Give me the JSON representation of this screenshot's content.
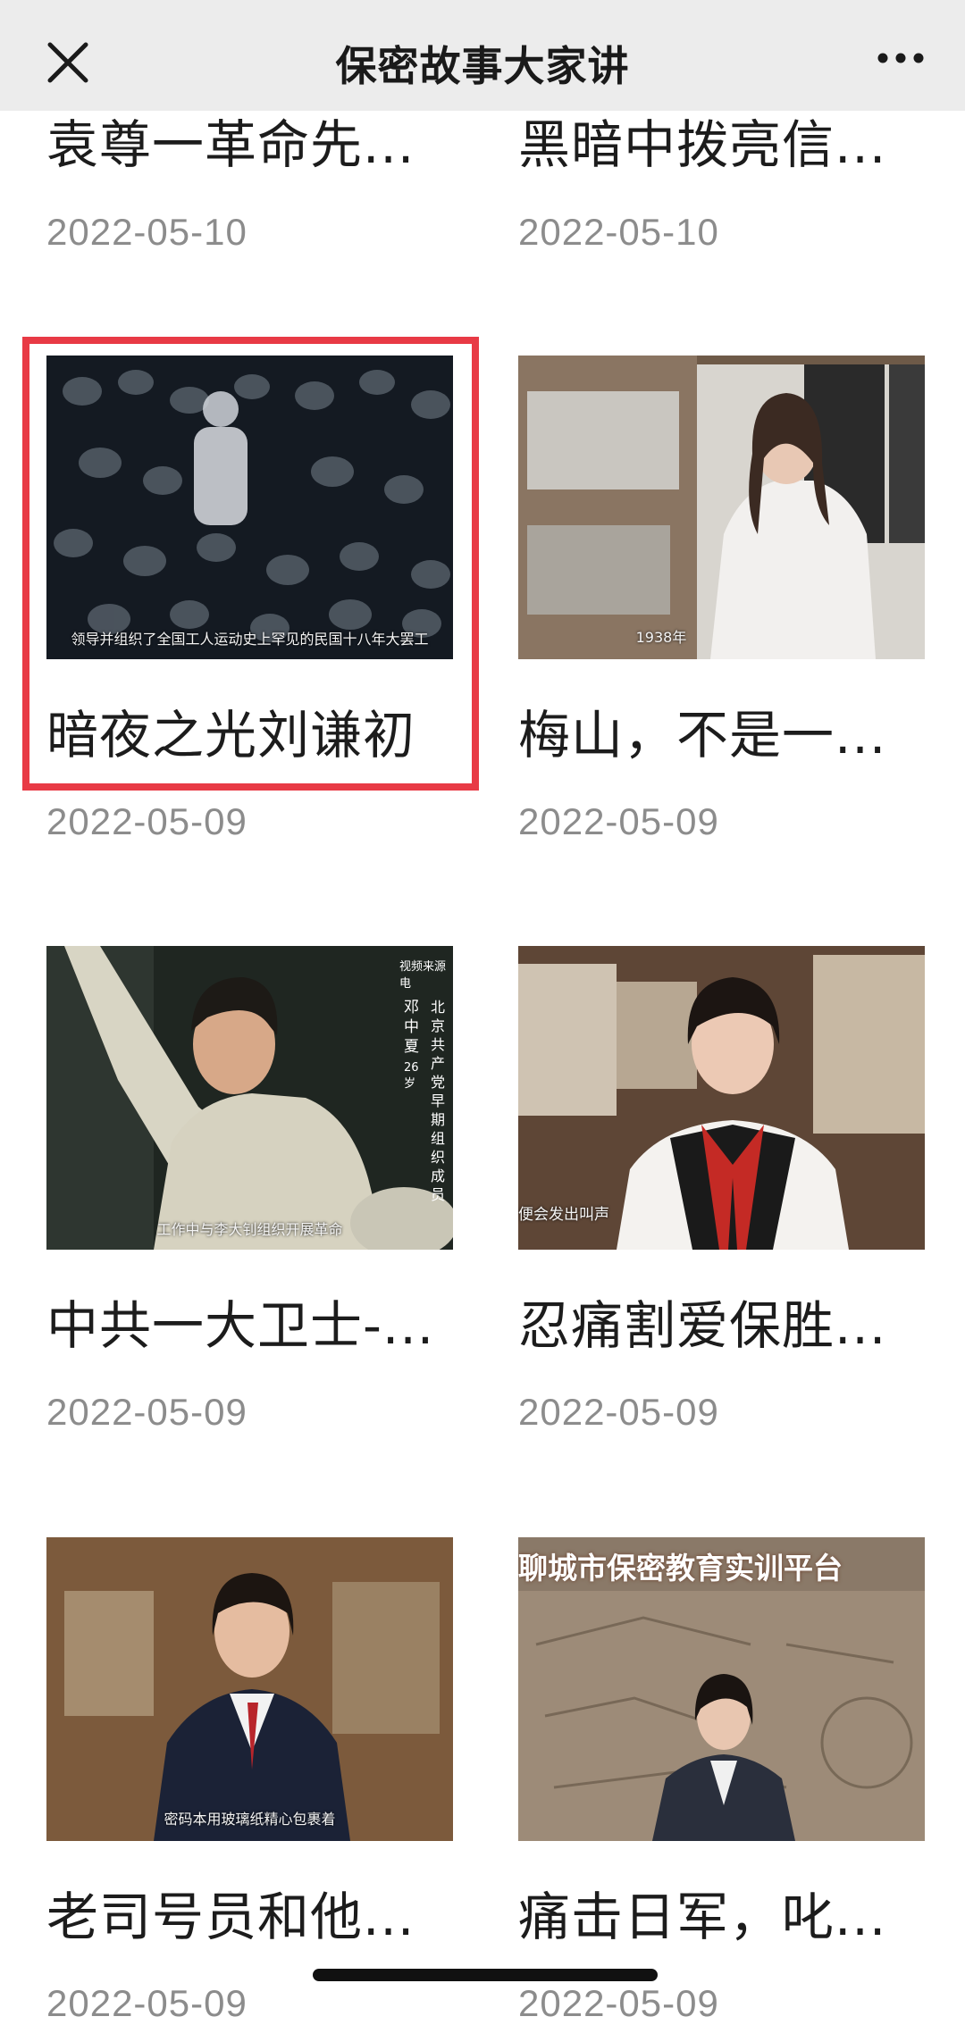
{
  "header": {
    "title": "保密故事大家讲",
    "close_icon": "close-icon",
    "more_icon": "more-dots-icon"
  },
  "cards": [
    {
      "title": "袁尊一革命先...",
      "date": "2022-05-10"
    },
    {
      "title": "黑暗中拨亮信...",
      "date": "2022-05-10"
    },
    {
      "title": "暗夜之光刘谦初",
      "date": "2022-05-09",
      "caption": "领导并组织了全国工人运动史上罕见的民国十八年大罢工",
      "highlighted": true
    },
    {
      "title": "梅山，不是一...",
      "date": "2022-05-09",
      "caption": "1938年"
    },
    {
      "title": "中共一大卫士-...",
      "date": "2022-05-09",
      "caption": "工作中与李大钊组织开展革命"
    },
    {
      "title": "忍痛割爱保胜...",
      "date": "2022-05-09",
      "caption": "便会发出叫声"
    },
    {
      "title": "老司号员和他...",
      "date": "2022-05-09",
      "caption": "密码本用玻璃纸精心包裹着"
    },
    {
      "title": "痛击日军，叱...",
      "date": "2022-05-09",
      "banner": "聊城市保密教育实训平台"
    }
  ],
  "overlay_texts": {
    "source": "视频来源电",
    "person_name": "邓中夏",
    "age": "26岁",
    "desc": "北京共产党早期组织成员"
  },
  "colors": {
    "highlight": "#e83a45",
    "date": "#8c8c8c",
    "title": "#1c1c1c"
  }
}
